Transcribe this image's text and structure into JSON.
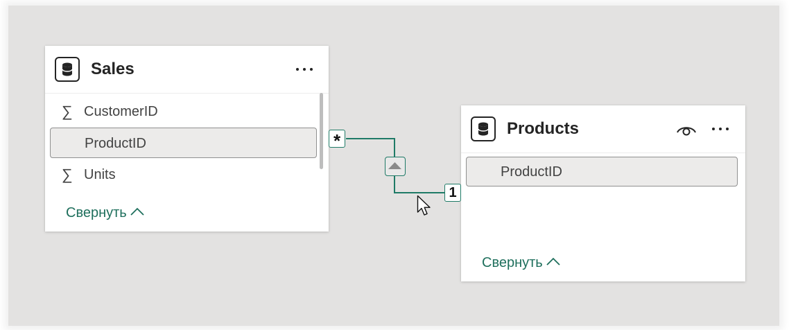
{
  "sales_table": {
    "title": "Sales",
    "fields": [
      {
        "name": "CustomerID",
        "icon": "sigma-icon",
        "symbol": "∑"
      },
      {
        "name": "ProductID",
        "icon": "",
        "symbol": ""
      },
      {
        "name": "Units",
        "icon": "sigma-icon",
        "symbol": "∑"
      }
    ],
    "collapse_label": "Свернуть"
  },
  "products_table": {
    "title": "Products",
    "fields": [
      {
        "name": "ProductID",
        "icon": "",
        "symbol": ""
      }
    ],
    "collapse_label": "Свернуть"
  },
  "relationship": {
    "from_cardinality": "*",
    "to_cardinality": "1",
    "line_color": "#1e7a66"
  },
  "colors": {
    "canvas": "#e3e2e1",
    "accent_text": "#1e6f5c",
    "selected_field_bg": "#ecebea"
  }
}
